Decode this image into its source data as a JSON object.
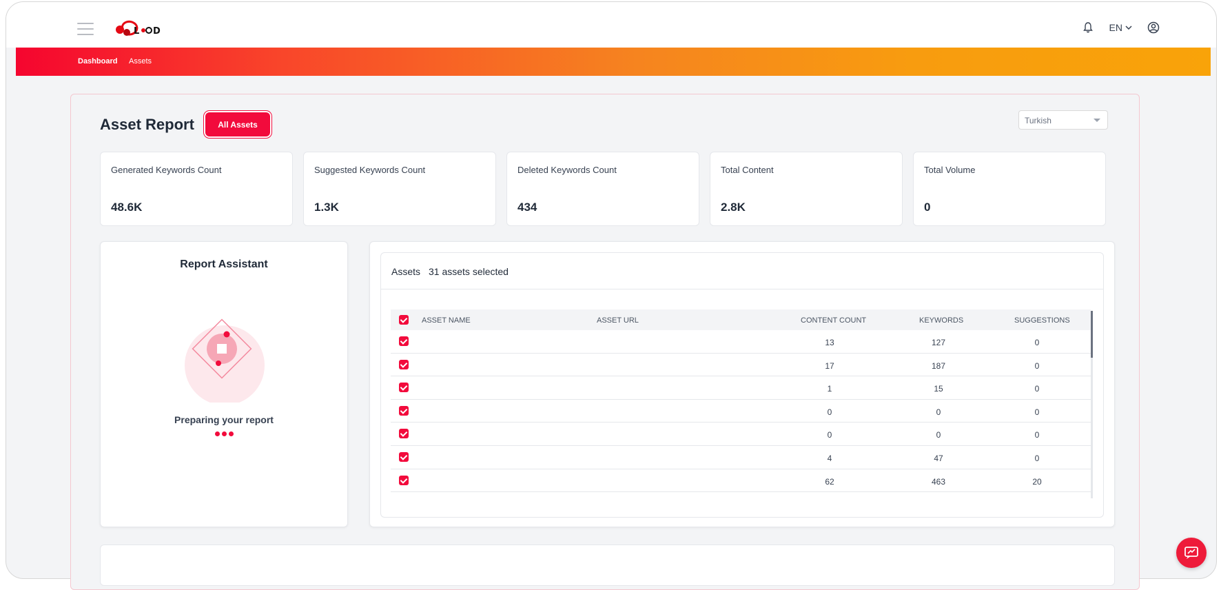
{
  "header": {
    "menu_icon": "hamburger-icon",
    "logo_icon": "brand-logo",
    "notification_icon": "bell-icon",
    "language": "EN",
    "language_icon": "chevron-down-icon",
    "user_icon": "user-circle-icon"
  },
  "nav": {
    "items": [
      {
        "label": "Dashboard",
        "active": true
      },
      {
        "label": "Assets",
        "active": false
      }
    ]
  },
  "report": {
    "title": "Asset Report",
    "filter_button": "All Assets",
    "language_select": "Turkish"
  },
  "stats": [
    {
      "label": "Generated Keywords Count",
      "value": "48.6K"
    },
    {
      "label": "Suggested Keywords Count",
      "value": "1.3K"
    },
    {
      "label": "Deleted Keywords Count",
      "value": "434"
    },
    {
      "label": "Total Content",
      "value": "2.8K"
    },
    {
      "label": "Total Volume",
      "value": "0"
    }
  ],
  "assistant": {
    "title": "Report Assistant",
    "status": "Preparing your report"
  },
  "assets": {
    "title": "Assets",
    "selected_text": "31 assets selected",
    "columns": [
      "ASSET NAME",
      "ASSET URL",
      "CONTENT COUNT",
      "KEYWORDS",
      "SUGGESTIONS"
    ],
    "rows": [
      {
        "content_count": "13",
        "keywords": "127",
        "suggestions": "0"
      },
      {
        "content_count": "17",
        "keywords": "187",
        "suggestions": "0"
      },
      {
        "content_count": "1",
        "keywords": "15",
        "suggestions": "0"
      },
      {
        "content_count": "0",
        "keywords": "0",
        "suggestions": "0"
      },
      {
        "content_count": "0",
        "keywords": "0",
        "suggestions": "0"
      },
      {
        "content_count": "4",
        "keywords": "47",
        "suggestions": "0"
      },
      {
        "content_count": "62",
        "keywords": "463",
        "suggestions": "20"
      }
    ]
  },
  "colors": {
    "accent": "#f20b3c",
    "gradient_start": "#f5052f",
    "gradient_end": "#f9a309"
  },
  "chat_icon": "chat-support-icon"
}
